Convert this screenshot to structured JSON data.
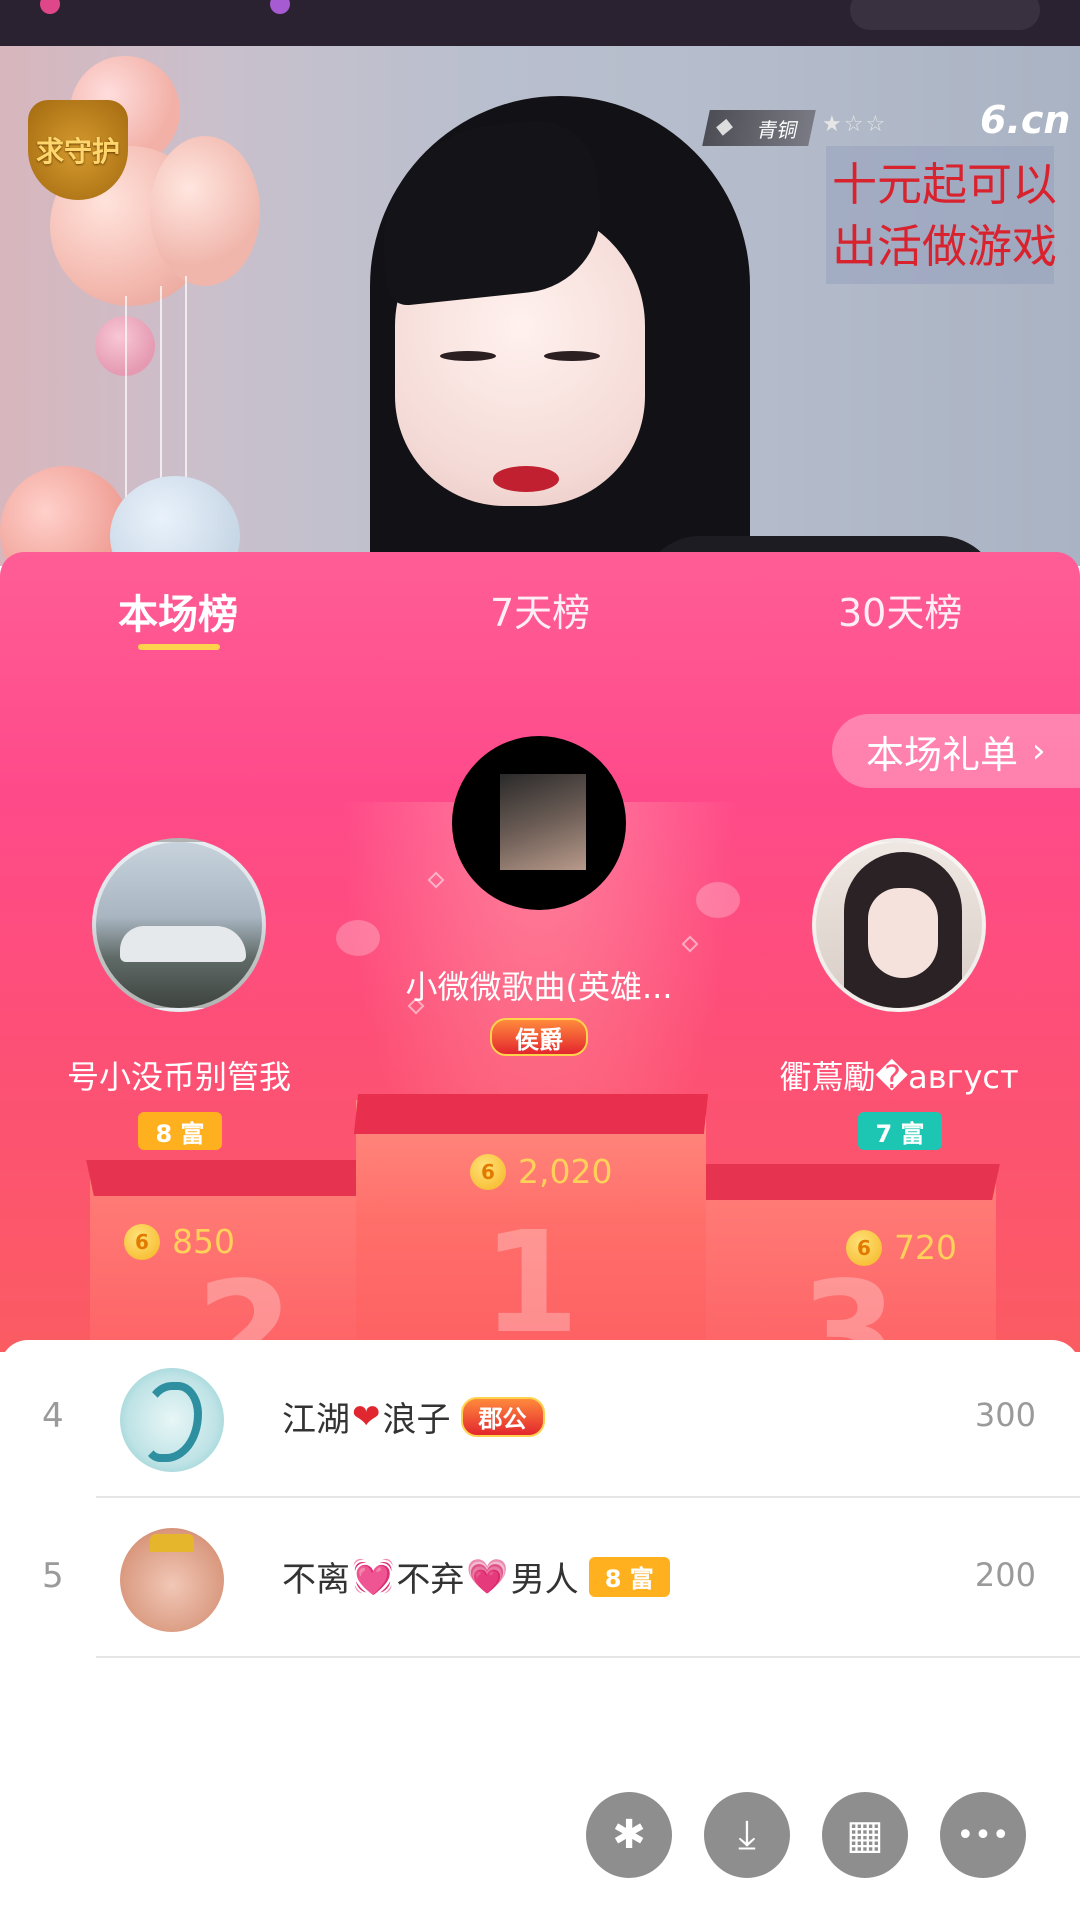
{
  "video": {
    "guard_label": "求守护",
    "rank_level": "青铜",
    "rank_stars": "★☆☆",
    "site_logo": "6.cn",
    "promo_lines": [
      "十元起可以",
      "出活做游戏"
    ]
  },
  "leaderboard": {
    "tabs": [
      {
        "label": "本场榜",
        "active": true
      },
      {
        "label": "7天榜",
        "active": false
      },
      {
        "label": "30天榜",
        "active": false
      }
    ],
    "gift_list_button": "本场礼单",
    "podium": {
      "first": {
        "rank": "1",
        "name": "小微微歌曲(英雄...",
        "tag": "侯爵",
        "coins": "2,020"
      },
      "second": {
        "rank": "2",
        "name": "号小没币别管我",
        "tag": "8 富",
        "coins": "850"
      },
      "third": {
        "rank": "3",
        "name": "衢蔦勵�август",
        "tag": "7 富",
        "coins": "720"
      }
    },
    "list": [
      {
        "rank": "4",
        "name_parts": [
          "江湖",
          "❤",
          "浪子"
        ],
        "tag": "郡公",
        "score": "300"
      },
      {
        "rank": "5",
        "name_parts": [
          "不离",
          "💓",
          "不弃",
          "💗",
          "男人"
        ],
        "tag": "8 富",
        "score": "200"
      }
    ]
  },
  "coin_symbol": "6",
  "fabs": [
    {
      "icon": "share-icon",
      "glyph": "✱"
    },
    {
      "icon": "download-icon",
      "glyph": "⤓"
    },
    {
      "icon": "grid-icon",
      "glyph": "▦"
    },
    {
      "icon": "more-icon",
      "glyph": "•••"
    }
  ],
  "colors": {
    "panel_pink": "#ff4a8a",
    "accent_yellow": "#ffd24d",
    "wealth_yellow": "#ffb01f",
    "wealth_cyan": "#1dc6b3",
    "coin_text": "#ffd05a"
  }
}
